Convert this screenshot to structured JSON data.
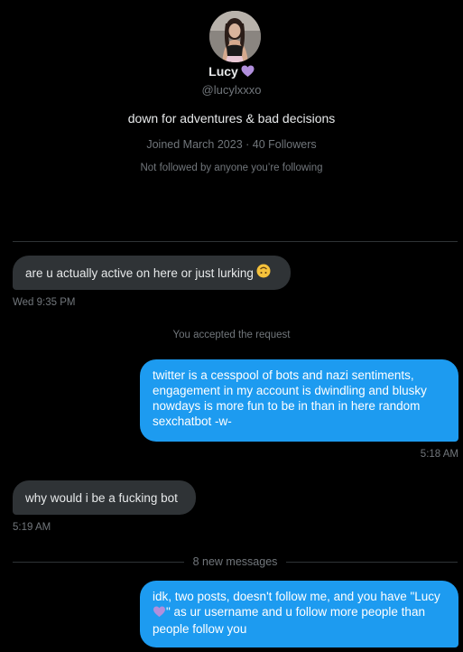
{
  "profile": {
    "name": "Lucy",
    "handle": "@lucylxxxo",
    "bio": "down for adventures & bad decisions",
    "meta": "Joined March 2023 · 40 Followers",
    "follow_note": "Not followed by anyone you’re following"
  },
  "messages": [
    {
      "direction": "incoming",
      "text": "are u actually active on here or just lurking",
      "time": "Wed 9:35 PM"
    },
    {
      "direction": "system",
      "text": "You accepted the request"
    },
    {
      "direction": "outgoing",
      "text": "twitter is a cesspool of bots and nazi sentiments, engagement in my account is dwindling and blusky nowdays is more fun to be in than in here random sexchatbot -w-",
      "time": "5:18 AM"
    },
    {
      "direction": "incoming",
      "text": "why would i be a fucking bot",
      "time": "5:19 AM"
    },
    {
      "direction": "outgoing",
      "text_before_emoji": "idk, two posts, doesn't follow me, and you have \"Lucy",
      "text_after_emoji": "\" as ur username and u follow more people than people follow you"
    }
  ],
  "new_messages_label": "8 new messages",
  "colors": {
    "background": "#000000",
    "outgoing_bubble": "#1d9bf0",
    "incoming_bubble": "#2f3336",
    "secondary_text": "#71767b",
    "heart": "#b18fdc"
  },
  "icons": {
    "name_emoji": "purple-heart",
    "lurking_emoji": "upside-down-face"
  }
}
